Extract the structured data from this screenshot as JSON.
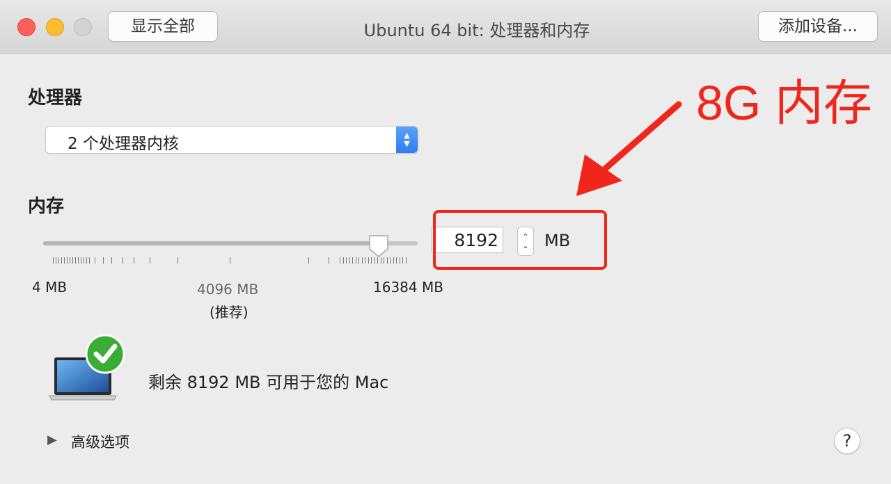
{
  "window": {
    "title": "Ubuntu 64 bit: 处理器和内存",
    "show_all_label": "显示全部",
    "add_device_label": "添加设备..."
  },
  "processor": {
    "heading": "处理器",
    "selected": "2 个处理器内核"
  },
  "memory": {
    "heading": "内存",
    "value": "8192",
    "unit": "MB",
    "slider_fraction": 0.895,
    "scale": {
      "min_label": "4 MB",
      "recommended_value": "4096 MB",
      "recommended_note": "(推荐)",
      "max_label": "16384 MB"
    }
  },
  "annotation": {
    "text": "8G 内存",
    "color": "#f0251b"
  },
  "status": {
    "text": "剩余 8192 MB 可用于您的 Mac"
  },
  "advanced": {
    "label": "高级选项"
  },
  "help": {
    "label": "?"
  }
}
